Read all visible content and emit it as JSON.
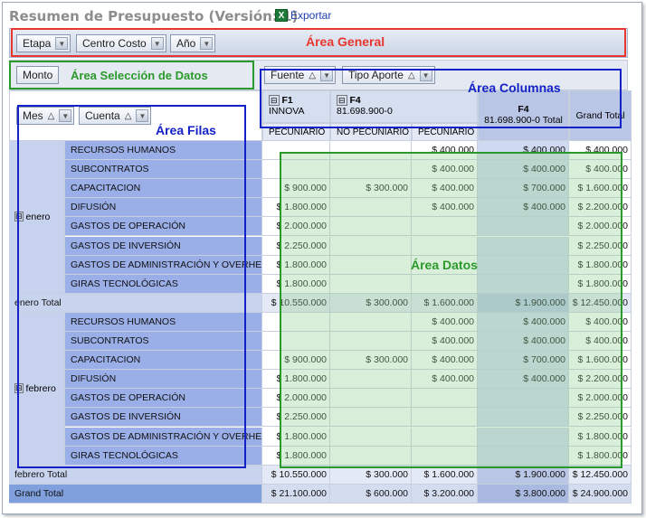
{
  "title": "Resumen de Presupuesto (Versión: 1)",
  "export_label": "Exportar",
  "toolbar": {
    "filters": [
      "Etapa",
      "Centro Costo",
      "Año"
    ]
  },
  "data_fields": [
    "Monto"
  ],
  "column_fields": [
    "Fuente",
    "Tipo Aporte"
  ],
  "row_fields": [
    "Mes",
    "Cuenta"
  ],
  "areas": {
    "general": "Área General",
    "data_selection": "Área Selección de Datos",
    "columns": "Área Columnas",
    "rows": "Área Filas",
    "data": "Área Datos"
  },
  "colors": {
    "red": "#e8352e",
    "green": "#2a9a2a",
    "blue": "#1420c8"
  },
  "column_headers": {
    "f1_name": "F1",
    "f1_sub": "INNOVA",
    "f4_name": "F4",
    "f4_sub": "81.698.900-0",
    "f4_total_name": "F4",
    "f4_total_sub": "81.698.900-0 Total",
    "grand_total": "Grand Total",
    "pecuniario_1": "PECUNIARIO",
    "no_pecuniario": "NO PECUNIARIO",
    "pecuniario_2": "PECUNIARIO"
  },
  "rows": [
    {
      "month": "enero",
      "label": "RECURSOS HUMANOS",
      "v": [
        "",
        "",
        "$ 400.000",
        "$ 400.000",
        "$ 400.000"
      ]
    },
    {
      "month": "",
      "label": "SUBCONTRATOS",
      "v": [
        "",
        "",
        "$ 400.000",
        "$ 400.000",
        "$ 400.000"
      ]
    },
    {
      "month": "",
      "label": "CAPACITACION",
      "v": [
        "$ 900.000",
        "$ 300.000",
        "$ 400.000",
        "$ 700.000",
        "$ 1.600.000"
      ]
    },
    {
      "month": "",
      "label": "DIFUSIÓN",
      "v": [
        "$ 1.800.000",
        "",
        "$ 400.000",
        "$ 400.000",
        "$ 2.200.000"
      ]
    },
    {
      "month": "",
      "label": "GASTOS DE OPERACIÓN",
      "v": [
        "$ 2.000.000",
        "",
        "",
        "",
        "$ 2.000.000"
      ]
    },
    {
      "month": "",
      "label": "GASTOS DE INVERSIÓN",
      "v": [
        "$ 2.250.000",
        "",
        "",
        "",
        "$ 2.250.000"
      ]
    },
    {
      "month": "",
      "label": "GASTOS DE ADMINISTRACIÓN Y OVERHEAD",
      "v": [
        "$ 1.800.000",
        "",
        "",
        "",
        "$ 1.800.000"
      ]
    },
    {
      "month": "",
      "label": "GIRAS TECNOLÓGICAS",
      "v": [
        "$ 1.800.000",
        "",
        "",
        "",
        "$ 1.800.000"
      ]
    },
    {
      "total": "enero Total",
      "v": [
        "$ 10.550.000",
        "$ 300.000",
        "$ 1.600.000",
        "$ 1.900.000",
        "$ 12.450.000"
      ]
    },
    {
      "month": "febrero",
      "label": "RECURSOS HUMANOS",
      "v": [
        "",
        "",
        "$ 400.000",
        "$ 400.000",
        "$ 400.000"
      ]
    },
    {
      "month": "",
      "label": "SUBCONTRATOS",
      "v": [
        "",
        "",
        "$ 400.000",
        "$ 400.000",
        "$ 400.000"
      ]
    },
    {
      "month": "",
      "label": "CAPACITACION",
      "v": [
        "$ 900.000",
        "$ 300.000",
        "$ 400.000",
        "$ 700.000",
        "$ 1.600.000"
      ]
    },
    {
      "month": "",
      "label": "DIFUSIÓN",
      "v": [
        "$ 1.800.000",
        "",
        "$ 400.000",
        "$ 400.000",
        "$ 2.200.000"
      ]
    },
    {
      "month": "",
      "label": "GASTOS DE OPERACIÓN",
      "v": [
        "$ 2.000.000",
        "",
        "",
        "",
        "$ 2.000.000"
      ]
    },
    {
      "month": "",
      "label": "GASTOS DE INVERSIÓN",
      "v": [
        "$ 2.250.000",
        "",
        "",
        "",
        "$ 2.250.000"
      ]
    },
    {
      "month": "",
      "label": "GASTOS DE ADMINISTRACIÓN Y OVERHEAD",
      "v": [
        "$ 1.800.000",
        "",
        "",
        "",
        "$ 1.800.000"
      ]
    },
    {
      "month": "",
      "label": "GIRAS TECNOLÓGICAS",
      "v": [
        "$ 1.800.000",
        "",
        "",
        "",
        "$ 1.800.000"
      ]
    },
    {
      "total": "febrero Total",
      "v": [
        "$ 10.550.000",
        "$ 300.000",
        "$ 1.600.000",
        "$ 1.900.000",
        "$ 12.450.000"
      ]
    },
    {
      "grand": "Grand Total",
      "v": [
        "$ 21.100.000",
        "$ 600.000",
        "$ 3.200.000",
        "$ 3.800.000",
        "$ 24.900.000"
      ]
    }
  ]
}
